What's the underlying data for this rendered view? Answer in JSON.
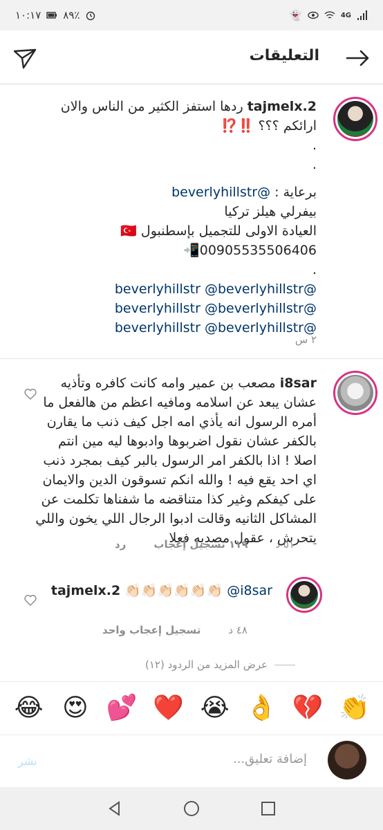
{
  "status_bar": {
    "time": "١٠:١٧",
    "battery": "٨٩٪",
    "network": "4G"
  },
  "header": {
    "title": "التعليقات"
  },
  "caption": {
    "username": "tajmelx.2",
    "text_line1": "ردها استفز الكثير من الناس والان",
    "text_line2": "ارائكم ؟؟؟ ‼️⁉️",
    "dot1": ".",
    "dot2": ".",
    "sponsor_label": "برعاية :",
    "sponsor_handle": "@beverlyhillstr",
    "line_brand": "بيفرلي هيلز تركيا",
    "line_clinic": "العيادة الاولى للتجميل بإسطنبول 🇹🇷",
    "line_phone": "00905535506406📲",
    "dot3": ".",
    "mention_rows": [
      [
        "@beverlyhillstr",
        "@beverlyhillstr"
      ],
      [
        "@beverlyhillstr",
        "@beverlyhillstr"
      ],
      [
        "@beverlyhillstr",
        "@beverlyhillstr"
      ]
    ],
    "time": "٢ س"
  },
  "comment1": {
    "username": "i8sar",
    "text": "مصعب بن عمير وامه كانت كافره وتأذيه عشان يبعد عن اسلامه ومافيه اعظم من هالفعل ما أمره الرسول انه يأذي امه اجل كيف ذنب ما يقارن بالكفر عشان نقول اضربوها وادبوها ليه مين انتم اصلا ! اذا بالكفر امر الرسول بالبر كيف بمجرد ذنب اي احد يقع فيه ! والله انكم تسوقون الدين والايمان على كيفكم وغير كذا متناقضه ما شفناها تكلمت عن المشاكل الثانيه وقالت ادبوا الرجال اللي يخون واللي يتحرش ، عقول مصديه فعلا",
    "time": "٥١ د",
    "likes": "١١٩ تسجيل إعجاب",
    "reply": "رد"
  },
  "reply1": {
    "username": "tajmelx.2",
    "mention": "@i8sar",
    "claps": "👏🏻👏🏻👏🏻👏🏻👏🏻👏🏻",
    "time": "٤٨ د",
    "likes": "تسجيل إعجاب واحد"
  },
  "more_replies": "عرض المزيد من الردود (١٢)",
  "emoji_bar": [
    "😂",
    "😍",
    "💕",
    "❤️",
    "😭",
    "👌",
    "💔",
    "👏"
  ],
  "input": {
    "placeholder": "إضافة تعليق...",
    "post_label": "نشر"
  },
  "colors": {
    "link": "#003569",
    "meta": "#8e8e8e",
    "avatar_ring": "#d63384",
    "post_disabled": "#b2dffc"
  }
}
